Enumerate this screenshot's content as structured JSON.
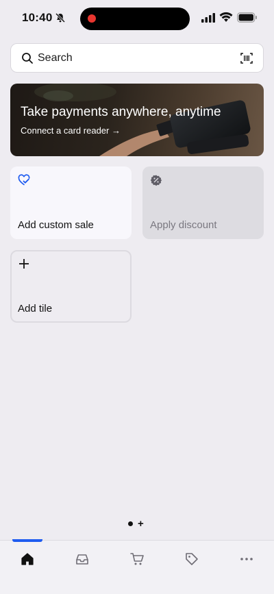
{
  "status_bar": {
    "time": "10:40"
  },
  "search": {
    "label": "Search"
  },
  "banner": {
    "title": "Take payments anywhere, anytime",
    "link": "Connect a card reader →"
  },
  "tiles": [
    {
      "label": "Add custom sale",
      "icon": "heart-check-icon"
    },
    {
      "label": "Apply discount",
      "icon": "discount-badge-icon"
    },
    {
      "label": "Add tile",
      "icon": "plus-icon"
    }
  ],
  "page_indicator": {
    "add": "+"
  },
  "tab_bar": {
    "items": [
      "home-icon",
      "inbox-icon",
      "cart-icon",
      "tag-icon",
      "more-icon"
    ],
    "accent": "#1f5cf0"
  }
}
